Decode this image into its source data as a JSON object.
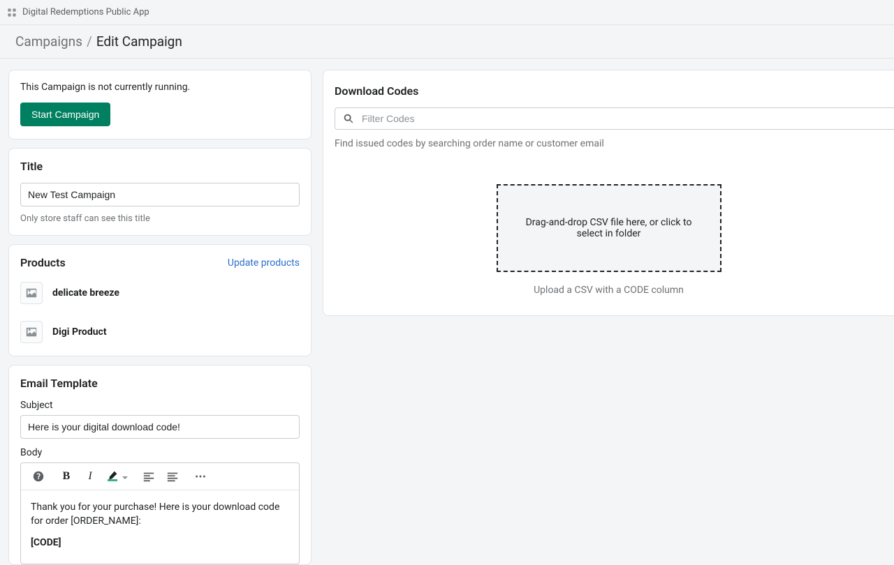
{
  "topbar": {
    "app_name": "Digital Redemptions Public App"
  },
  "breadcrumb": {
    "root": "Campaigns",
    "current": "Edit Campaign"
  },
  "status": {
    "message": "This Campaign is not currently running.",
    "start_button": "Start Campaign"
  },
  "title_card": {
    "heading": "Title",
    "value": "New Test Campaign",
    "helper": "Only store staff can see this title"
  },
  "products_card": {
    "heading": "Products",
    "update_link": "Update products",
    "items": [
      {
        "name": "delicate breeze"
      },
      {
        "name": "Digi Product"
      }
    ]
  },
  "email_card": {
    "heading": "Email Template",
    "subject_label": "Subject",
    "subject_value": "Here is your digital download code!",
    "body_label": "Body",
    "body_line1": "Thank you for your purchase! Here is your download code for order [ORDER_NAME]:",
    "body_code": "[CODE]"
  },
  "codes_card": {
    "heading": "Download Codes",
    "filter_placeholder": "Filter Codes",
    "filter_help": "Find issued codes by searching order name or customer email",
    "dropzone_text": "Drag-and-drop CSV file here, or click to select in folder",
    "upload_help": "Upload a CSV with a CODE column"
  }
}
